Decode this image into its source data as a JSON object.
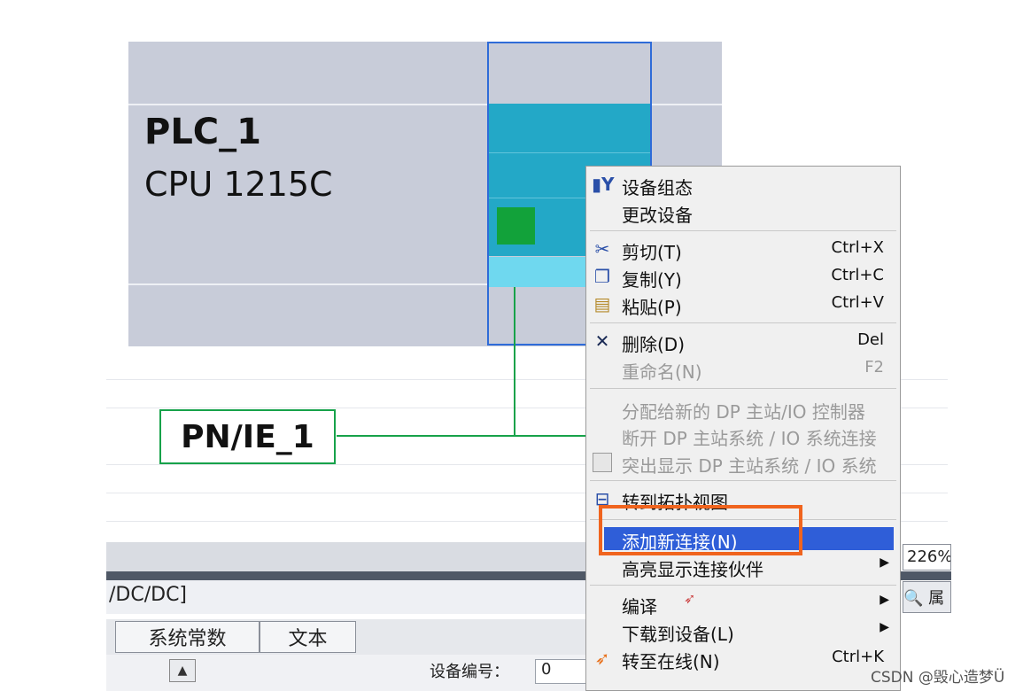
{
  "device": {
    "name": "PLC_1",
    "type": "CPU 1215C"
  },
  "network": {
    "name": "PN/IE_1"
  },
  "zoom": "226%",
  "find_label": "🔍 属",
  "inspector": {
    "title": "/DC/DC]",
    "tabs": [
      "系统常数",
      "文本"
    ],
    "device_number_label": "设备编号：",
    "device_number_value": "0"
  },
  "context_menu": {
    "items": [
      {
        "icon": "device-config-icon",
        "label": "设备组态",
        "shortcut": "",
        "enabled": true
      },
      {
        "icon": "",
        "label": "更改设备",
        "shortcut": "",
        "enabled": true
      },
      {
        "icon": "scissors-icon",
        "label": "剪切(T)",
        "shortcut": "Ctrl+X",
        "enabled": true
      },
      {
        "icon": "copy-icon",
        "label": "复制(Y)",
        "shortcut": "Ctrl+C",
        "enabled": true
      },
      {
        "icon": "paste-icon",
        "label": "粘贴(P)",
        "shortcut": "Ctrl+V",
        "enabled": true
      },
      {
        "icon": "delete-icon",
        "label": "删除(D)",
        "shortcut": "Del",
        "enabled": true
      },
      {
        "icon": "",
        "label": "重命名(N)",
        "shortcut": "F2",
        "enabled": false
      },
      {
        "icon": "",
        "label": "分配给新的 DP 主站/IO 控制器",
        "shortcut": "",
        "enabled": false
      },
      {
        "icon": "",
        "label": "断开 DP 主站系统 / IO 系统连接",
        "shortcut": "",
        "enabled": false
      },
      {
        "icon": "checkbox-icon",
        "label": "突出显示 DP 主站系统 / IO 系统",
        "shortcut": "",
        "enabled": false
      },
      {
        "icon": "topology-icon",
        "label": "转到拓扑视图",
        "shortcut": "",
        "enabled": true
      },
      {
        "icon": "",
        "label": "添加新连接(N)",
        "shortcut": "",
        "enabled": true,
        "highlighted": true
      },
      {
        "icon": "",
        "label": "高亮显示连接伙伴",
        "shortcut": "",
        "enabled": true,
        "submenu": true
      },
      {
        "icon": "",
        "label": "编译",
        "shortcut": "",
        "enabled": true,
        "submenu": true
      },
      {
        "icon": "",
        "label": "下载到设备(L)",
        "shortcut": "",
        "enabled": true,
        "submenu": true
      },
      {
        "icon": "go-online-icon",
        "label": "转至在线(N)",
        "shortcut": "Ctrl+K",
        "enabled": true
      }
    ]
  },
  "watermark": "CSDN @毁心造梦Ü",
  "colors": {
    "accent": "#2f5ed8",
    "highlight_border": "#f0641e",
    "network_green": "#17a24a",
    "cpu_teal": "#23a8c7"
  }
}
